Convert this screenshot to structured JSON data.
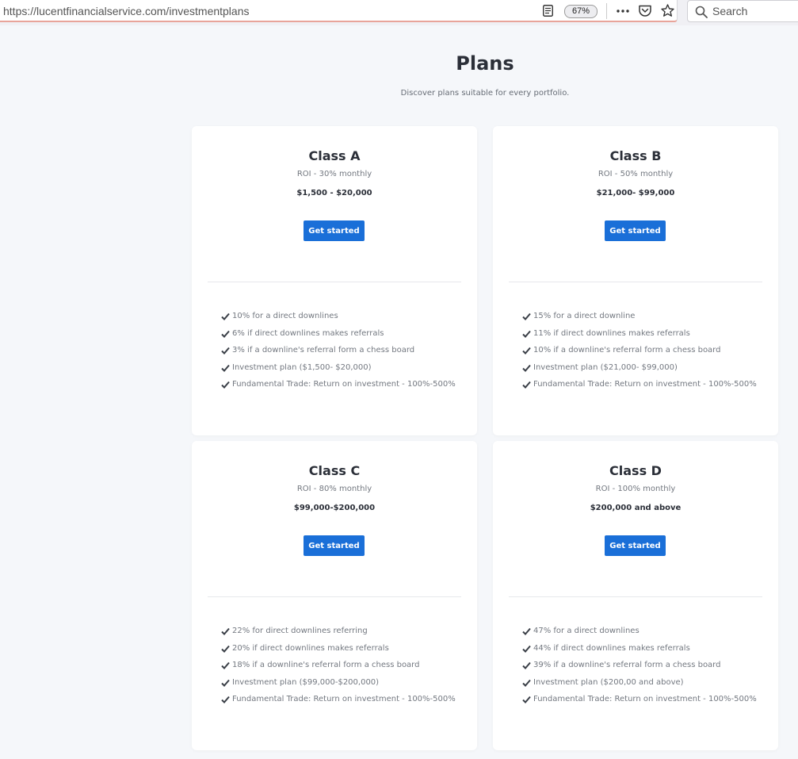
{
  "browser": {
    "url_host": "https://lucentfinancialservice.com/",
    "url_path": "investmentplans",
    "zoom": "67%",
    "search_placeholder": "Search",
    "icons": [
      "reader-view-icon",
      "more-icon",
      "pocket-icon",
      "bookmark-star-icon",
      "search-icon"
    ],
    "urlbar_accent_color": "#e8a49a"
  },
  "page": {
    "title": "Plans",
    "subtitle": "Discover plans suitable for every portfolio."
  },
  "accent_color": "#1a6fd8",
  "plans": [
    {
      "name": "Class A",
      "roi": "ROI - 30% monthly",
      "range": "$1,500 - $20,000",
      "button": "Get started",
      "features": [
        "10% for a direct downlines",
        "6% if direct downlines makes referrals",
        "3% if a downline's referral form a chess board",
        "Investment plan ($1,500- $20,000)",
        "Fundamental Trade: Return on investment - 100%-500%"
      ]
    },
    {
      "name": "Class B",
      "roi": "ROI - 50% monthly",
      "range": "$21,000- $99,000",
      "button": "Get started",
      "features": [
        "15% for a direct downline",
        "11% if direct downlines makes referrals",
        "10% if a downline's referral form a chess board",
        "Investment plan ($21,000- $99,000)",
        "Fundamental Trade: Return on investment - 100%-500%"
      ]
    },
    {
      "name": "Class C",
      "roi": "ROI - 80% monthly",
      "range": "$99,000-$200,000",
      "button": "Get started",
      "features": [
        "22% for direct downlines referring",
        "20% if direct downlines makes referrals",
        "18% if a downline's referral form a chess board",
        "Investment plan ($99,000-$200,000)",
        "Fundamental Trade: Return on investment - 100%-500%"
      ]
    },
    {
      "name": "Class D",
      "roi": "ROI - 100% monthly",
      "range": "$200,000 and above",
      "button": "Get started",
      "features": [
        "47% for a direct downlines",
        "44% if direct downlines makes referrals",
        "39% if a downline's referral form a chess board",
        "Investment plan ($200,00 and above)",
        "Fundamental Trade: Return on investment - 100%-500%"
      ]
    }
  ]
}
